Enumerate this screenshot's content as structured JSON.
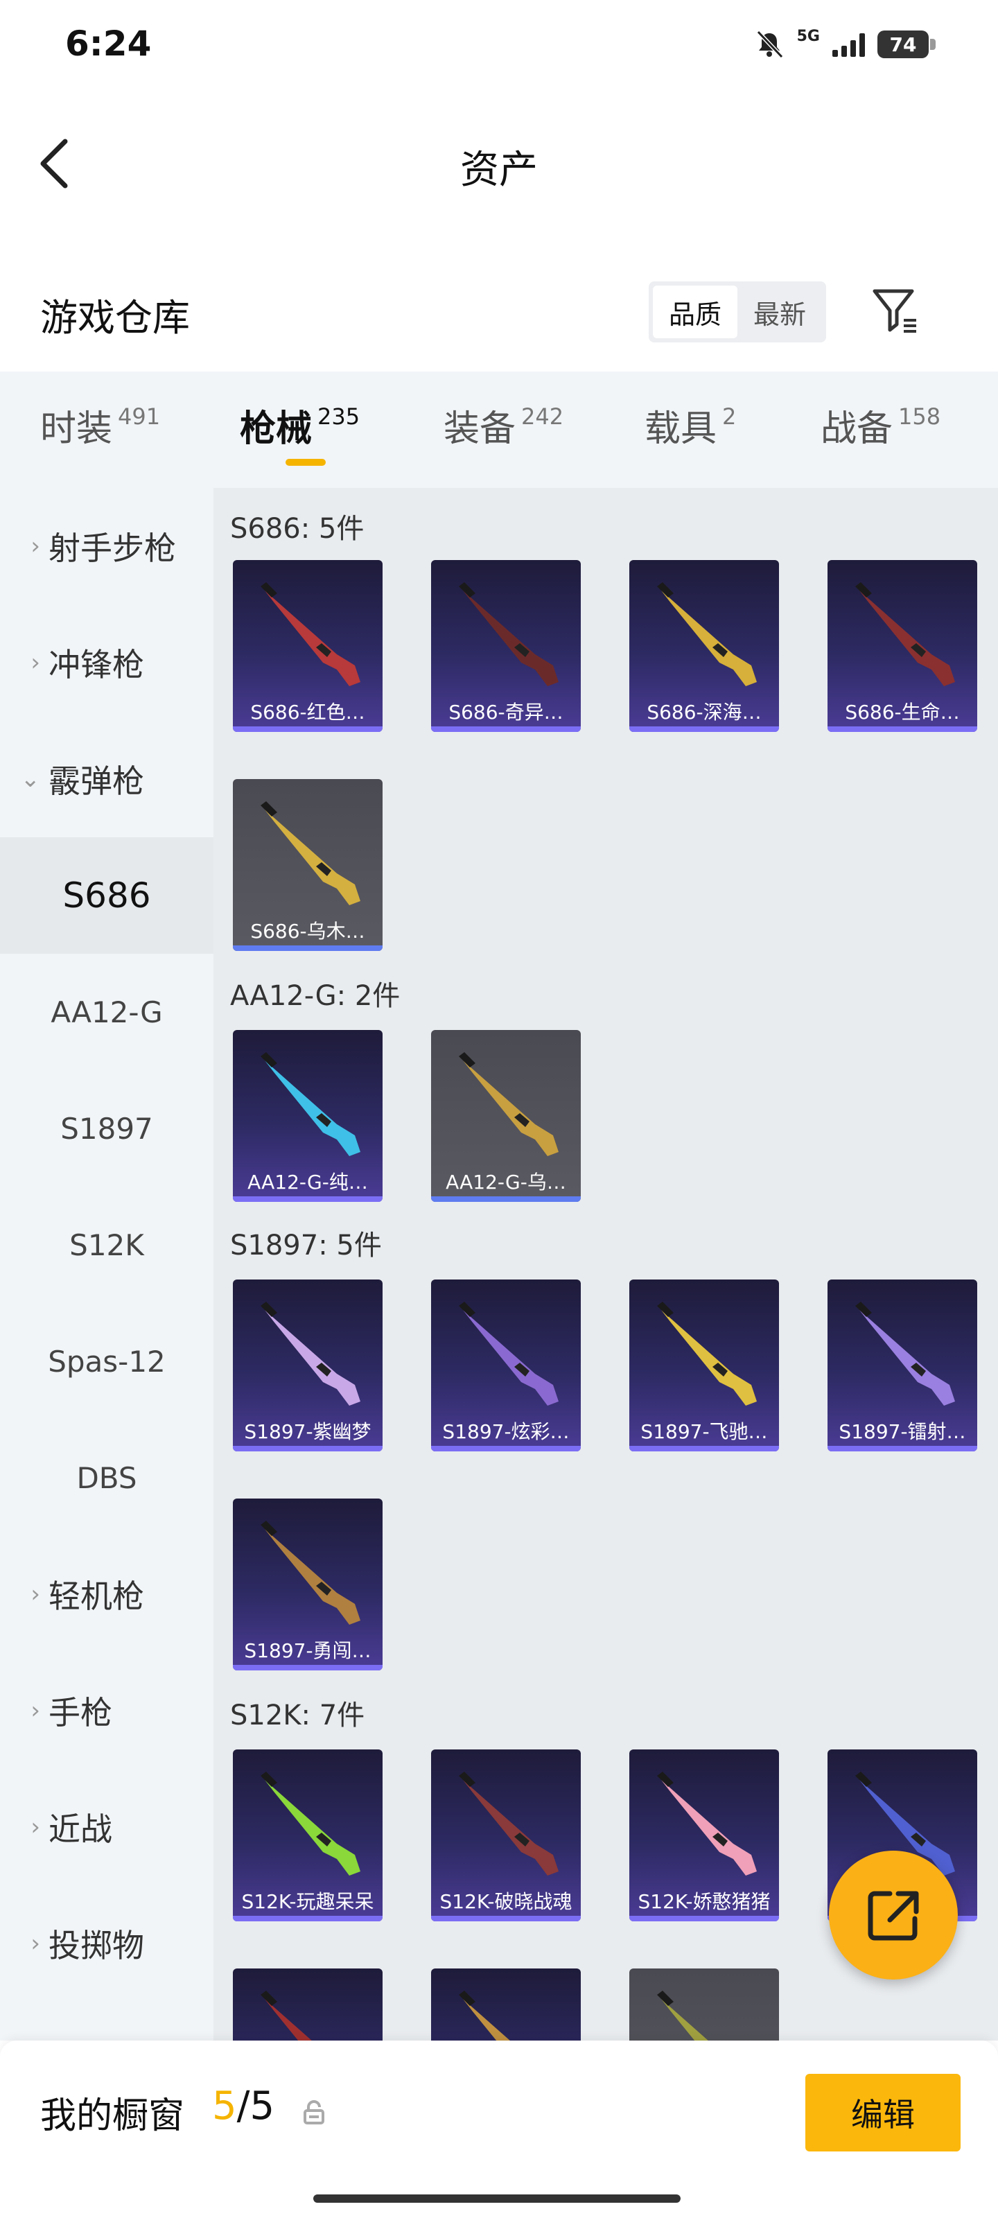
{
  "status_bar": {
    "time": "6:24",
    "network": "5G",
    "battery": "74"
  },
  "header": {
    "title": "资产"
  },
  "warehouse": {
    "title": "游戏仓库",
    "sort_options": [
      "品质",
      "最新"
    ],
    "active_sort": "品质"
  },
  "tabs": [
    {
      "label": "时装",
      "count": "491"
    },
    {
      "label": "枪械",
      "count": "235"
    },
    {
      "label": "装备",
      "count": "242"
    },
    {
      "label": "载具",
      "count": "2"
    },
    {
      "label": "战备",
      "count": "158"
    }
  ],
  "active_tab": "枪械",
  "sidebar": {
    "items": [
      {
        "label": "射手步枪",
        "expandable": true
      },
      {
        "label": "冲锋枪",
        "expandable": true
      },
      {
        "label": "霰弹枪",
        "expandable": true,
        "expanded": true
      },
      {
        "label": "S686",
        "sub": true,
        "active": true
      },
      {
        "label": "AA12-G",
        "sub": true
      },
      {
        "label": "S1897",
        "sub": true
      },
      {
        "label": "S12K",
        "sub": true
      },
      {
        "label": "Spas-12",
        "sub": true
      },
      {
        "label": "DBS",
        "sub": true
      },
      {
        "label": "轻机枪",
        "expandable": true
      },
      {
        "label": "手枪",
        "expandable": true
      },
      {
        "label": "近战",
        "expandable": true
      },
      {
        "label": "投掷物",
        "expandable": true
      }
    ]
  },
  "groups": [
    {
      "title": "S686: 5件",
      "cards": [
        {
          "name": "S686-红色…",
          "color": "#b83a3a",
          "gray": false
        },
        {
          "name": "S686-奇异…",
          "color": "#6b2a2a",
          "gray": false
        },
        {
          "name": "S686-深海…",
          "color": "#d6b03a",
          "gray": false
        },
        {
          "name": "S686-生命…",
          "color": "#8a3030",
          "gray": false
        },
        {
          "name": "S686-乌木…",
          "color": "#d4b040",
          "gray": true
        }
      ]
    },
    {
      "title": "AA12-G: 2件",
      "cards": [
        {
          "name": "AA12-G-纯…",
          "color": "#3fc0e8",
          "gray": false
        },
        {
          "name": "AA12-G-乌…",
          "color": "#c8a040",
          "gray": true
        }
      ]
    },
    {
      "title": "S1897: 5件",
      "cards": [
        {
          "name": "S1897-紫幽梦",
          "color": "#c9a8e8",
          "gray": false
        },
        {
          "name": "S1897-炫彩…",
          "color": "#8a6ad0",
          "gray": false
        },
        {
          "name": "S1897-飞驰…",
          "color": "#e0c040",
          "gray": false
        },
        {
          "name": "S1897-镭射…",
          "color": "#9a80e0",
          "gray": false
        },
        {
          "name": "S1897-勇闯…",
          "color": "#b08040",
          "gray": false
        }
      ]
    },
    {
      "title": "S12K: 7件",
      "cards": [
        {
          "name": "S12K-玩趣呆呆",
          "color": "#8ad83a",
          "gray": false
        },
        {
          "name": "S12K-破晓战魂",
          "color": "#8a3a3a",
          "gray": false
        },
        {
          "name": "S12K-娇憨猪猪",
          "color": "#f0a0b8",
          "gray": false
        },
        {
          "name": "",
          "color": "#5060d0",
          "gray": false
        },
        {
          "name": "",
          "color": "#a03030",
          "gray": false
        },
        {
          "name": "",
          "color": "#c09040",
          "gray": false
        },
        {
          "name": "",
          "color": "#a0a040",
          "gray": true
        }
      ]
    }
  ],
  "bottom": {
    "label": "我的橱窗",
    "current": "5",
    "total": "5",
    "edit_label": "编辑"
  }
}
